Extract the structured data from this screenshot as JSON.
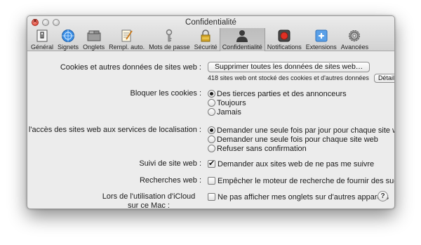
{
  "window": {
    "title": "Confidentialité"
  },
  "toolbar": {
    "items": [
      {
        "label": "Général",
        "icon": "general-icon"
      },
      {
        "label": "Signets",
        "icon": "bookmarks-icon"
      },
      {
        "label": "Onglets",
        "icon": "tabs-icon"
      },
      {
        "label": "Rempl. auto.",
        "icon": "autofill-icon"
      },
      {
        "label": "Mots de passe",
        "icon": "passwords-icon"
      },
      {
        "label": "Sécurité",
        "icon": "security-icon"
      },
      {
        "label": "Confidentialité",
        "icon": "privacy-icon",
        "active": true
      },
      {
        "label": "Notifications",
        "icon": "notifications-icon"
      },
      {
        "label": "Extensions",
        "icon": "extensions-icon"
      },
      {
        "label": "Avancées",
        "icon": "advanced-icon"
      }
    ]
  },
  "cookies_data": {
    "label": "Cookies et autres données de sites web :",
    "remove_button": "Supprimer toutes les données de sites web…",
    "count_text": "418 sites web ont stocké des cookies et d'autres données",
    "details_button": "Détails…"
  },
  "block_cookies": {
    "label": "Bloquer les cookies :",
    "options": [
      {
        "label": "Des tierces parties et des annonceurs",
        "selected": true
      },
      {
        "label": "Toujours",
        "selected": false
      },
      {
        "label": "Jamais",
        "selected": false
      }
    ]
  },
  "location": {
    "label": "Limiter l'accès des sites web aux services de localisation :",
    "options": [
      {
        "label": "Demander une seule fois par jour pour chaque site web",
        "selected": true
      },
      {
        "label": "Demander une seule fois pour chaque site web",
        "selected": false
      },
      {
        "label": "Refuser sans confirmation",
        "selected": false
      }
    ]
  },
  "tracking": {
    "label": "Suivi de site web :",
    "checkbox_label": "Demander aux sites web de ne pas me suivre",
    "checked": true
  },
  "search": {
    "label": "Recherches web :",
    "checkbox_label": "Empêcher le moteur de recherche de fournir des suggestions",
    "checked": false
  },
  "icloud": {
    "label": "Lors de l'utilisation d'iCloud sur ce Mac :",
    "checkbox_label": "Ne pas afficher mes onglets sur d'autres appareils",
    "checked": false
  },
  "help": {
    "label": "?"
  },
  "colors": {
    "accent_selected_tab": "#c4c4c4",
    "close_button": "#d6392b"
  }
}
